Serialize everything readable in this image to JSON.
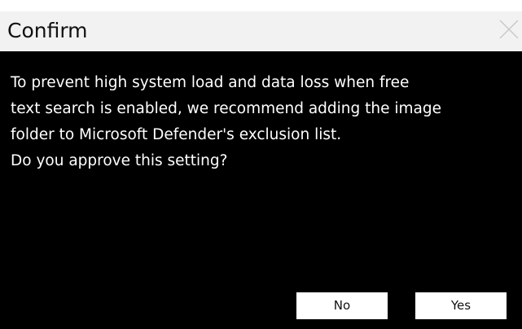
{
  "dialog": {
    "title": "Confirm",
    "close_icon": "close-icon",
    "message_lines": [
      "To prevent high system load and data loss when free",
      "text search is enabled, we recommend adding the image",
      "folder to Microsoft Defender's exclusion list.",
      "Do you approve this setting?"
    ],
    "buttons": {
      "no_label": "No",
      "yes_label": "Yes"
    }
  },
  "colors": {
    "titlebar_bg": "#f2f2f2",
    "body_bg": "#000000",
    "text_light": "#ffffff",
    "button_bg": "#ffffff"
  }
}
